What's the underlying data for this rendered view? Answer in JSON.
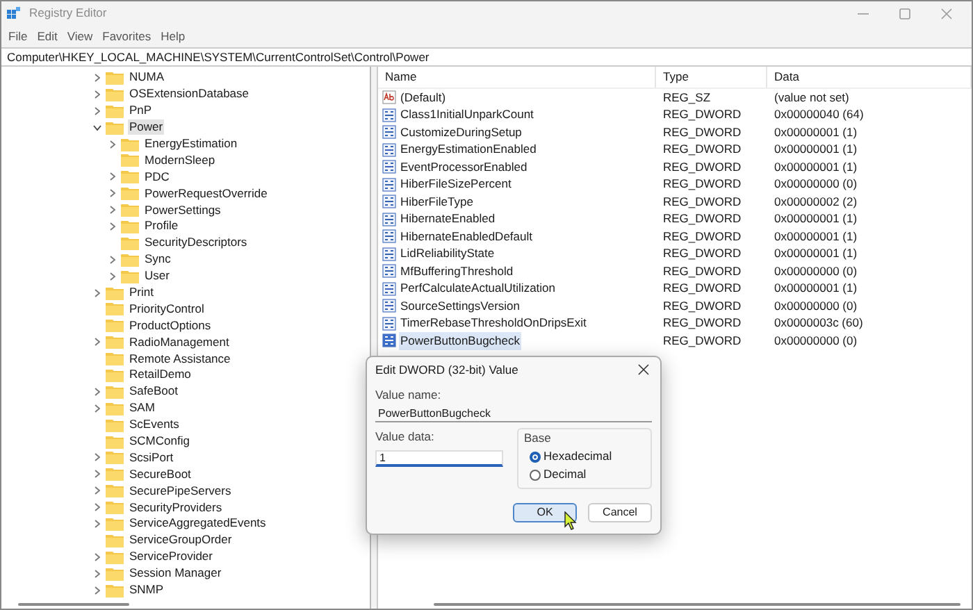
{
  "window": {
    "title": "Registry Editor"
  },
  "menu": [
    "File",
    "Edit",
    "View",
    "Favorites",
    "Help"
  ],
  "address": "Computer\\HKEY_LOCAL_MACHINE\\SYSTEM\\CurrentControlSet\\Control\\Power",
  "tree": [
    {
      "label": "NUMA",
      "expandable": true,
      "expanded": false,
      "selected": false
    },
    {
      "label": "OSExtensionDatabase",
      "expandable": true,
      "expanded": false,
      "selected": false
    },
    {
      "label": "PnP",
      "expandable": true,
      "expanded": false,
      "selected": false
    },
    {
      "label": "Power",
      "expandable": true,
      "expanded": true,
      "selected": true,
      "children": [
        {
          "label": "EnergyEstimation",
          "expandable": true,
          "expanded": false,
          "selected": false
        },
        {
          "label": "ModernSleep",
          "expandable": false,
          "expanded": false,
          "selected": false
        },
        {
          "label": "PDC",
          "expandable": true,
          "expanded": false,
          "selected": false
        },
        {
          "label": "PowerRequestOverride",
          "expandable": true,
          "expanded": false,
          "selected": false
        },
        {
          "label": "PowerSettings",
          "expandable": true,
          "expanded": false,
          "selected": false
        },
        {
          "label": "Profile",
          "expandable": true,
          "expanded": false,
          "selected": false
        },
        {
          "label": "SecurityDescriptors",
          "expandable": false,
          "expanded": false,
          "selected": false
        },
        {
          "label": "Sync",
          "expandable": true,
          "expanded": false,
          "selected": false
        },
        {
          "label": "User",
          "expandable": true,
          "expanded": false,
          "selected": false
        }
      ]
    },
    {
      "label": "Print",
      "expandable": true,
      "expanded": false,
      "selected": false
    },
    {
      "label": "PriorityControl",
      "expandable": false,
      "expanded": false,
      "selected": false
    },
    {
      "label": "ProductOptions",
      "expandable": false,
      "expanded": false,
      "selected": false
    },
    {
      "label": "RadioManagement",
      "expandable": true,
      "expanded": false,
      "selected": false
    },
    {
      "label": "Remote Assistance",
      "expandable": false,
      "expanded": false,
      "selected": false
    },
    {
      "label": "RetailDemo",
      "expandable": false,
      "expanded": false,
      "selected": false
    },
    {
      "label": "SafeBoot",
      "expandable": true,
      "expanded": false,
      "selected": false
    },
    {
      "label": "SAM",
      "expandable": true,
      "expanded": false,
      "selected": false
    },
    {
      "label": "ScEvents",
      "expandable": false,
      "expanded": false,
      "selected": false
    },
    {
      "label": "SCMConfig",
      "expandable": false,
      "expanded": false,
      "selected": false
    },
    {
      "label": "ScsiPort",
      "expandable": true,
      "expanded": false,
      "selected": false
    },
    {
      "label": "SecureBoot",
      "expandable": true,
      "expanded": false,
      "selected": false
    },
    {
      "label": "SecurePipeServers",
      "expandable": true,
      "expanded": false,
      "selected": false
    },
    {
      "label": "SecurityProviders",
      "expandable": true,
      "expanded": false,
      "selected": false
    },
    {
      "label": "ServiceAggregatedEvents",
      "expandable": true,
      "expanded": false,
      "selected": false
    },
    {
      "label": "ServiceGroupOrder",
      "expandable": false,
      "expanded": false,
      "selected": false
    },
    {
      "label": "ServiceProvider",
      "expandable": true,
      "expanded": false,
      "selected": false
    },
    {
      "label": "Session Manager",
      "expandable": true,
      "expanded": false,
      "selected": false
    },
    {
      "label": "SNMP",
      "expandable": true,
      "expanded": false,
      "selected": false
    }
  ],
  "table": {
    "columns": [
      "Name",
      "Type",
      "Data"
    ],
    "rows": [
      {
        "kind": "string",
        "name": "(Default)",
        "type": "REG_SZ",
        "data": "(value not set)",
        "selected": false
      },
      {
        "kind": "dword",
        "name": "Class1InitialUnparkCount",
        "type": "REG_DWORD",
        "data": "0x00000040 (64)",
        "selected": false
      },
      {
        "kind": "dword",
        "name": "CustomizeDuringSetup",
        "type": "REG_DWORD",
        "data": "0x00000001 (1)",
        "selected": false
      },
      {
        "kind": "dword",
        "name": "EnergyEstimationEnabled",
        "type": "REG_DWORD",
        "data": "0x00000001 (1)",
        "selected": false
      },
      {
        "kind": "dword",
        "name": "EventProcessorEnabled",
        "type": "REG_DWORD",
        "data": "0x00000001 (1)",
        "selected": false
      },
      {
        "kind": "dword",
        "name": "HiberFileSizePercent",
        "type": "REG_DWORD",
        "data": "0x00000000 (0)",
        "selected": false
      },
      {
        "kind": "dword",
        "name": "HiberFileType",
        "type": "REG_DWORD",
        "data": "0x00000002 (2)",
        "selected": false
      },
      {
        "kind": "dword",
        "name": "HibernateEnabled",
        "type": "REG_DWORD",
        "data": "0x00000001 (1)",
        "selected": false
      },
      {
        "kind": "dword",
        "name": "HibernateEnabledDefault",
        "type": "REG_DWORD",
        "data": "0x00000001 (1)",
        "selected": false
      },
      {
        "kind": "dword",
        "name": "LidReliabilityState",
        "type": "REG_DWORD",
        "data": "0x00000001 (1)",
        "selected": false
      },
      {
        "kind": "dword",
        "name": "MfBufferingThreshold",
        "type": "REG_DWORD",
        "data": "0x00000000 (0)",
        "selected": false
      },
      {
        "kind": "dword",
        "name": "PerfCalculateActualUtilization",
        "type": "REG_DWORD",
        "data": "0x00000001 (1)",
        "selected": false
      },
      {
        "kind": "dword",
        "name": "SourceSettingsVersion",
        "type": "REG_DWORD",
        "data": "0x00000000 (0)",
        "selected": false
      },
      {
        "kind": "dword",
        "name": "TimerRebaseThresholdOnDripsExit",
        "type": "REG_DWORD",
        "data": "0x0000003c (60)",
        "selected": false
      },
      {
        "kind": "dword",
        "name": "PowerButtonBugcheck",
        "type": "REG_DWORD",
        "data": "0x00000000 (0)",
        "selected": true
      }
    ]
  },
  "dialog": {
    "title": "Edit DWORD (32-bit) Value",
    "value_name_label": "Value name:",
    "value_name": "PowerButtonBugcheck",
    "value_data_label": "Value data:",
    "value_data": "1",
    "base_label": "Base",
    "base_options": [
      {
        "label": "Hexadecimal",
        "selected": true
      },
      {
        "label": "Decimal",
        "selected": false
      }
    ],
    "buttons": [
      {
        "label": "OK",
        "default": true
      },
      {
        "label": "Cancel",
        "default": false
      }
    ]
  }
}
